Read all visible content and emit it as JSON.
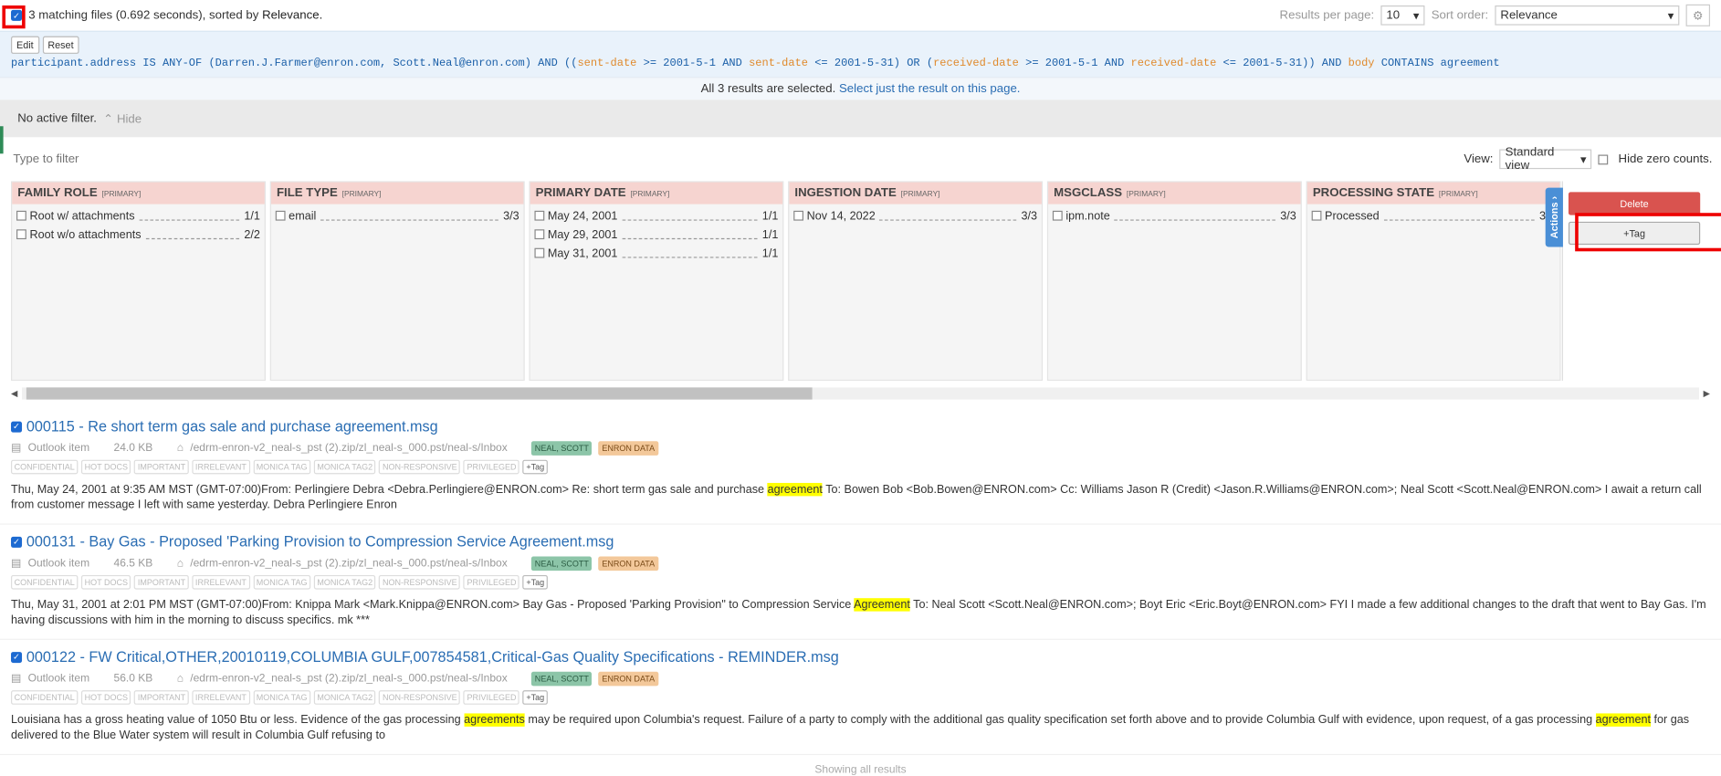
{
  "header": {
    "result_summary": "3 matching files (0.692 seconds), sorted by",
    "sorted_by": "Relevance.",
    "results_per_page_label": "Results per page:",
    "results_per_page_value": "10",
    "sort_order_label": "Sort order:",
    "sort_order_value": "Relevance"
  },
  "query": {
    "edit_label": "Edit",
    "reset_label": "Reset",
    "text_p1": "participant.address IS ANY-OF (Darren.J.Farmer@enron.com, Scott.Neal@enron.com) AND ((",
    "sent1": "sent-date",
    "text_p2": " >= 2001-5-1 AND ",
    "sent2": "sent-date",
    "text_p3": " <= 2001-5-31) OR (",
    "recv1": "received-date",
    "text_p4": " >= 2001-5-1 AND ",
    "recv2": "received-date",
    "text_p5": " <= 2001-5-31)) AND ",
    "body": "body",
    "text_p6": " CONTAINS agreement"
  },
  "selection": {
    "text": "All 3 results are selected.",
    "link": "Select just the result on this page."
  },
  "filter": {
    "no_active": "No active filter.",
    "hide_label": "Hide",
    "type_placeholder": "Type to filter",
    "view_label": "View:",
    "view_value": "Standard view",
    "hide_zero_label": "Hide zero counts."
  },
  "facets": [
    {
      "title": "FAMILY ROLE",
      "tag": "[PRIMARY]",
      "items": [
        {
          "label": "Root w/ attachments",
          "count": "1/1"
        },
        {
          "label": "Root w/o attachments",
          "count": "2/2"
        }
      ]
    },
    {
      "title": "FILE TYPE",
      "tag": "[PRIMARY]",
      "items": [
        {
          "label": "email",
          "count": "3/3"
        }
      ]
    },
    {
      "title": "PRIMARY DATE",
      "tag": "[PRIMARY]",
      "items": [
        {
          "label": "May 24, 2001",
          "count": "1/1"
        },
        {
          "label": "May 29, 2001",
          "count": "1/1"
        },
        {
          "label": "May 31, 2001",
          "count": "1/1"
        }
      ]
    },
    {
      "title": "INGESTION DATE",
      "tag": "[PRIMARY]",
      "items": [
        {
          "label": "Nov 14, 2022",
          "count": "3/3"
        }
      ]
    },
    {
      "title": "MSGCLASS",
      "tag": "[PRIMARY]",
      "items": [
        {
          "label": "ipm.note",
          "count": "3/3"
        }
      ]
    },
    {
      "title": "PROCESSING STATE",
      "tag": "[PRIMARY]",
      "items": [
        {
          "label": "Processed",
          "count": "3/3"
        }
      ]
    }
  ],
  "actions": {
    "tab_label": "Actions",
    "delete_label": "Delete",
    "tag_label": "Tag"
  },
  "tag_names": [
    "CONFIDENTIAL",
    "HOT DOCS",
    "IMPORTANT",
    "IRRELEVANT",
    "MONICA TAG",
    "MONICA TAG2",
    "NON-RESPONSIVE",
    "PRIVILEGED"
  ],
  "add_tag_label": "Tag",
  "chips": [
    "NEAL, SCOTT",
    "ENRON DATA"
  ],
  "results": [
    {
      "title": "000115 - Re  short term gas sale and purchase agreement.msg",
      "type": "Outlook item",
      "size": "24.0 KB",
      "path": "/edrm-enron-v2_neal-s_pst (2).zip/zl_neal-s_000.pst/neal-s/Inbox",
      "s1": "Thu, May 24, 2001 at 9:35 AM MST (GMT-07:00)From: Perlingiere Debra <Debra.Perlingiere@ENRON.com> Re: short term gas sale and purchase ",
      "m1": "agreement",
      "s2": " To: Bowen Bob <Bob.Bowen@ENRON.com> Cc: Williams Jason R (Credit) <Jason.R.Williams@ENRON.com>; Neal Scott <Scott.Neal@ENRON.com> I await a return call from customer message I left with same yesterday. Debra Perlingiere Enron",
      "m2": "",
      "s3": ""
    },
    {
      "title": "000131 - Bay Gas - Proposed 'Parking Provision  to Compression Service Agreement.msg",
      "type": "Outlook item",
      "size": "46.5 KB",
      "path": "/edrm-enron-v2_neal-s_pst (2).zip/zl_neal-s_000.pst/neal-s/Inbox",
      "s1": "Thu, May 31, 2001 at 2:01 PM MST (GMT-07:00)From: Knippa Mark <Mark.Knippa@ENRON.com> Bay Gas - Proposed 'Parking Provision\" to Compression Service ",
      "m1": "Agreement",
      "s2": " To: Neal Scott <Scott.Neal@ENRON.com>; Boyt Eric <Eric.Boyt@ENRON.com> FYI I made a few additional changes to the draft that went to Bay Gas. I'm having discussions with him in the morning to discuss specifics. mk ***",
      "m2": "",
      "s3": ""
    },
    {
      "title": "000122 - FW  Critical,OTHER,20010119,COLUMBIA GULF,007854581,Critical-Gas Quality Specifications - REMINDER.msg",
      "type": "Outlook item",
      "size": "56.0 KB",
      "path": "/edrm-enron-v2_neal-s_pst (2).zip/zl_neal-s_000.pst/neal-s/Inbox",
      "s1": "Louisiana has a gross heating value of 1050 Btu or less. Evidence of the gas processing ",
      "m1": "agreements",
      "s2": " may be required upon Columbia's request. Failure of a party to comply with the additional gas quality specification set forth above and to provide Columbia Gulf with evidence, upon request, of a gas processing ",
      "m2": "agreement",
      "s3": " for gas delivered to the Blue Water system will result in Columbia Gulf refusing to"
    }
  ],
  "footer": "Showing all results"
}
